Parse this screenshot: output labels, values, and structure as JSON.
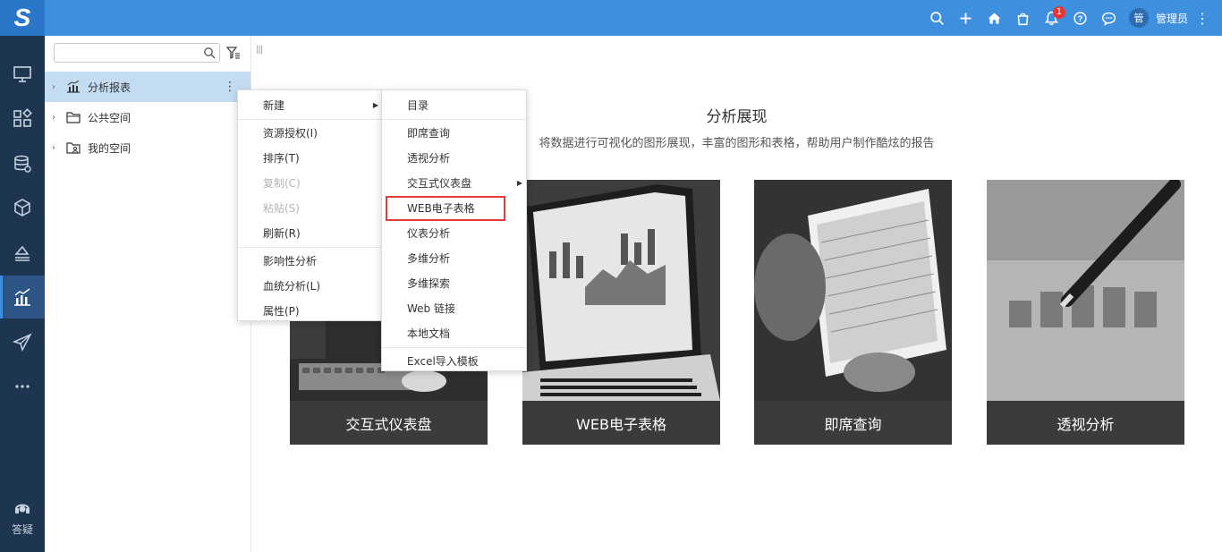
{
  "app": {
    "logo": "S"
  },
  "topbar": {
    "icons": [
      "search-icon",
      "plus-icon",
      "home-icon",
      "bag-icon",
      "bell-icon",
      "help-icon",
      "chat-icon"
    ],
    "notification_count": "1",
    "avatar_text": "管",
    "username": "管理员",
    "more": "⋮"
  },
  "leftnav": {
    "items": [
      "monitor-icon",
      "apps-icon",
      "database-icon",
      "cube-icon",
      "layers-icon",
      "chart-icon",
      "send-icon",
      "more-icon"
    ],
    "active_index": 5,
    "help_label": "答疑"
  },
  "tree": {
    "search": {
      "value": "",
      "placeholder": ""
    },
    "items": [
      {
        "label": "分析报表",
        "selected": true
      },
      {
        "label": "公共空间",
        "selected": false
      },
      {
        "label": "我的空间",
        "selected": false
      }
    ],
    "row_menu": "⋮"
  },
  "main": {
    "collapse_glyph": "|||",
    "title": "分析展现",
    "subtitle": "将数据进行可视化的图形展现，丰富的图形和表格，帮助用户制作酷炫的报告",
    "cards": [
      {
        "label": "交互式仪表盘"
      },
      {
        "label": "WEB电子表格"
      },
      {
        "label": "即席查询"
      },
      {
        "label": "透视分析"
      }
    ]
  },
  "context_menu": {
    "items": [
      {
        "label": "新建",
        "disabled": false,
        "submenu": true
      },
      {
        "label": "资源授权(I)",
        "disabled": false
      },
      {
        "label": "排序(T)",
        "disabled": false
      },
      {
        "label": "复制(C)",
        "disabled": true
      },
      {
        "label": "粘贴(S)",
        "disabled": true
      },
      {
        "label": "刷新(R)",
        "disabled": false
      },
      {
        "label": "影响性分析",
        "disabled": false
      },
      {
        "label": "血统分析(L)",
        "disabled": false
      },
      {
        "label": "属性(P)",
        "disabled": false
      }
    ]
  },
  "submenu": {
    "items": [
      {
        "label": "目录"
      },
      {
        "label": "即席查询"
      },
      {
        "label": "透视分析"
      },
      {
        "label": "交互式仪表盘",
        "submenu": true
      },
      {
        "label": "WEB电子表格",
        "highlighted": true
      },
      {
        "label": "仪表分析"
      },
      {
        "label": "多维分析"
      },
      {
        "label": "多维探索"
      },
      {
        "label": "Web 链接"
      },
      {
        "label": "本地文档"
      },
      {
        "label": "Excel导入模板"
      }
    ]
  },
  "colors": {
    "topbar": "#3f8fdf",
    "leftnav": "#1e3552",
    "selected_row": "#c4dcf2",
    "highlight": "#e03c3c"
  }
}
